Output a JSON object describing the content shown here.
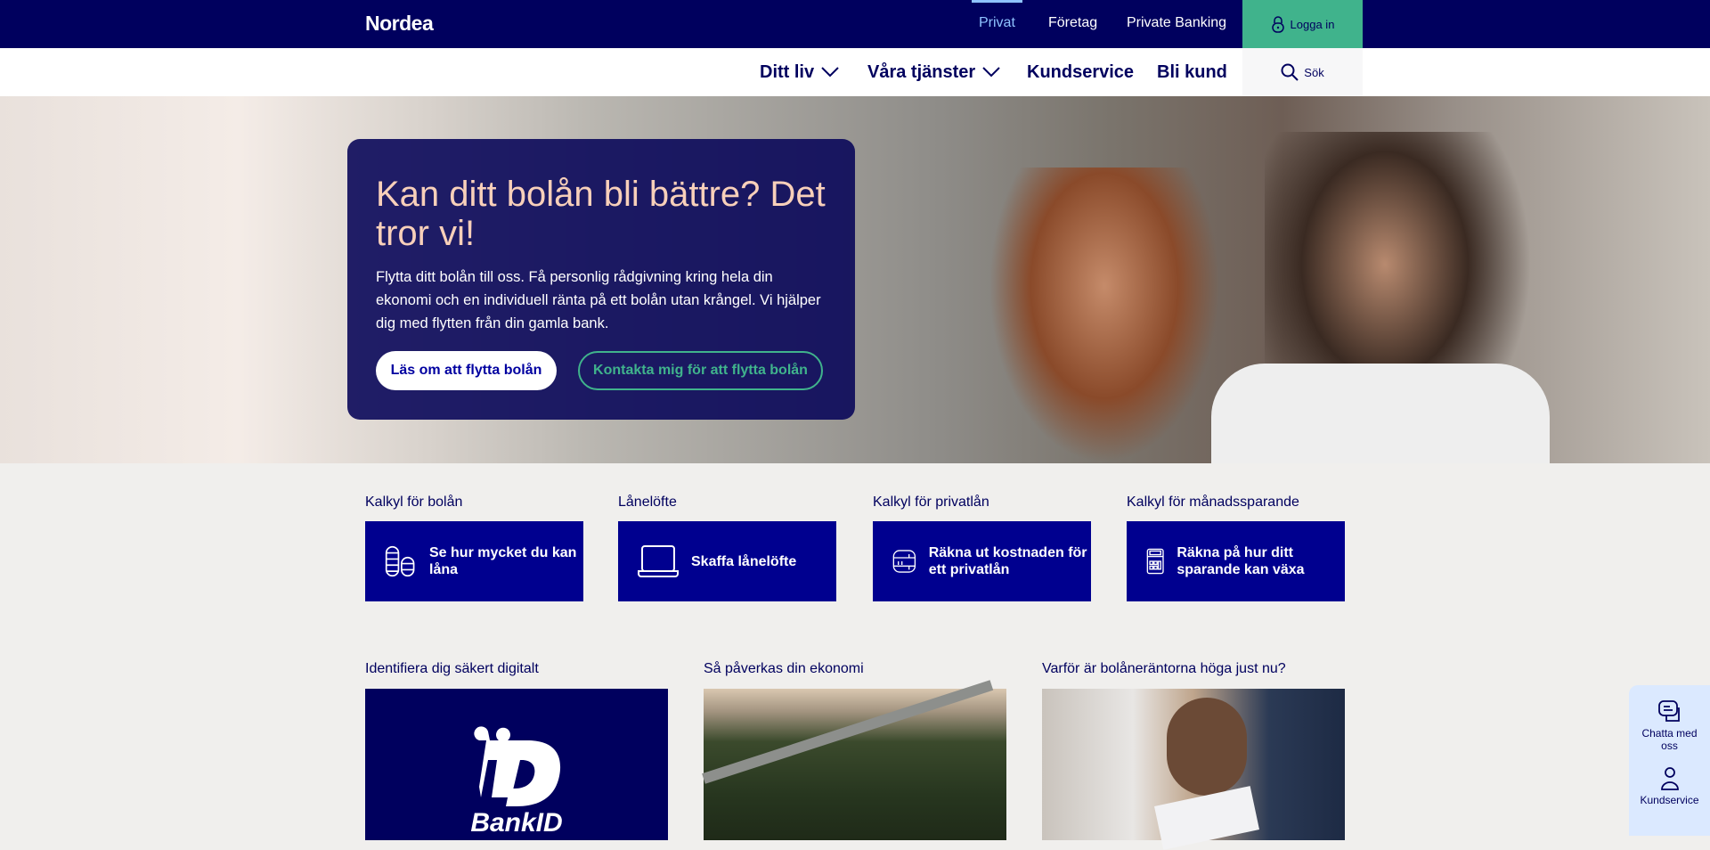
{
  "header": {
    "logo": "Nordea",
    "segments": [
      {
        "label": "Privat",
        "active": true
      },
      {
        "label": "Företag"
      },
      {
        "label": "Private Banking"
      }
    ],
    "login": "Logga in",
    "login_color": "#40b38c"
  },
  "nav": {
    "items": [
      "Ditt liv",
      "Våra tjänster",
      "Kundservice",
      "Bli kund"
    ],
    "search": "Sök"
  },
  "hero": {
    "title": "Kan ditt bolån bli bättre? Det tror vi!",
    "body": "Flytta ditt bolån till oss. Få personlig rådgivning kring hela din ekonomi och en individuell ränta på ett bolån utan krångel. Vi hjälper dig med flytten från din gamla bank.",
    "primary_button": "Läs om att flytta bolån",
    "secondary_button": "Kontakta mig för att flytta bolån"
  },
  "tools": [
    {
      "label": "Kalkyl för bolån",
      "tile": "Se hur mycket du kan låna",
      "icon": "coins-icon"
    },
    {
      "label": "Lånelöfte",
      "tile": "Skaffa lånelöfte",
      "icon": "laptop-icon"
    },
    {
      "label": "Kalkyl för privatlån",
      "tile": "Räkna ut kostnaden för ett privatlån",
      "icon": "sliders-icon"
    },
    {
      "label": "Kalkyl för månadssparande",
      "tile": "Räkna på hur ditt sparande kan växa",
      "icon": "calculator-icon"
    }
  ],
  "articles": [
    {
      "label": "Identifiera dig säkert digitalt",
      "logo_text": "BankID"
    },
    {
      "label": "Så påverkas din ekonomi"
    },
    {
      "label": "Varför är bolåneräntorna höga just nu?"
    }
  ],
  "chat": {
    "chat": "Chatta med oss",
    "service": "Kundservice"
  }
}
